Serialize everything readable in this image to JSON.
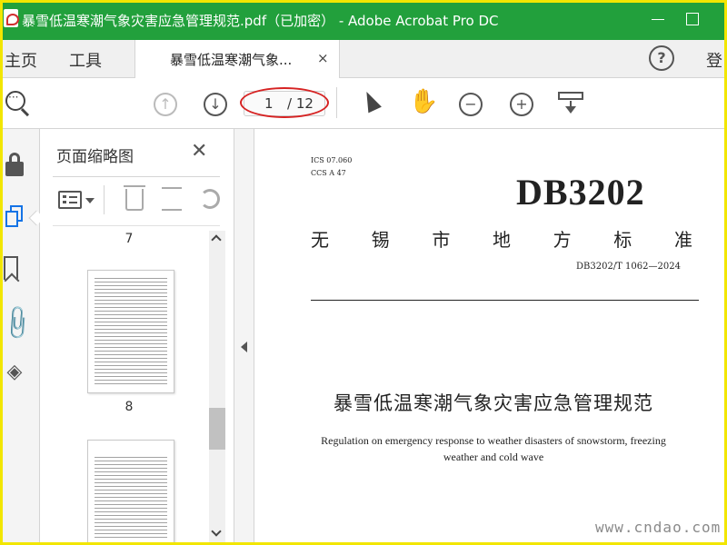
{
  "window": {
    "title": "暴雪低温寒潮气象灾害应急管理规范.pdf（已加密） - Adobe Acrobat Pro DC",
    "minimize_glyph": "—",
    "maximize_glyph": "☐"
  },
  "menu": {
    "home": "主页",
    "tools": "工具",
    "doc_tab": "暴雪低温寒潮气象...",
    "doc_tab_close": "×",
    "help": "?",
    "login": "登"
  },
  "toolbar": {
    "current_page": "1",
    "total_pages": "/ 12",
    "prev_glyph": "↑",
    "next_glyph": "↓",
    "zoom_out_glyph": "−",
    "zoom_in_glyph": "+",
    "hand_glyph": "✋",
    "icons": [
      "search-icon",
      "prev-page-icon",
      "next-page-icon",
      "select-cursor-icon",
      "hand-icon",
      "zoom-out-icon",
      "zoom-in-icon",
      "fit-page-icon"
    ],
    "hand_tool_color": "#1473e6",
    "highlight_oval_color": "#d62323"
  },
  "rail": {
    "icons": [
      "lock-icon",
      "pages-icon",
      "bookmark-icon",
      "paperclip-icon",
      "layers-icon"
    ],
    "clip_glyph": "📎",
    "layers_glyph": "◈"
  },
  "thumbnails": {
    "title": "页面缩略图",
    "close_glyph": "✕",
    "pages": [
      {
        "label": "7"
      },
      {
        "label": "8"
      }
    ]
  },
  "document": {
    "ics": "ICS 07.060",
    "ccs": "CCS A 47",
    "code": "DB3202",
    "region_chars": [
      "无",
      "锡",
      "市",
      "地",
      "方",
      "标",
      "准"
    ],
    "number": "DB3202/T 1062—2024",
    "title": "暴雪低温寒潮气象灾害应急管理规范",
    "subtitle_line1": "Regulation on emergency response to weather disasters of snowstorm, freezing",
    "subtitle_line2": "weather and cold wave"
  },
  "watermark": {
    "text": "www.cndao.com"
  },
  "colors": {
    "titlebar": "#22a03c",
    "frame": "#f2e600"
  }
}
